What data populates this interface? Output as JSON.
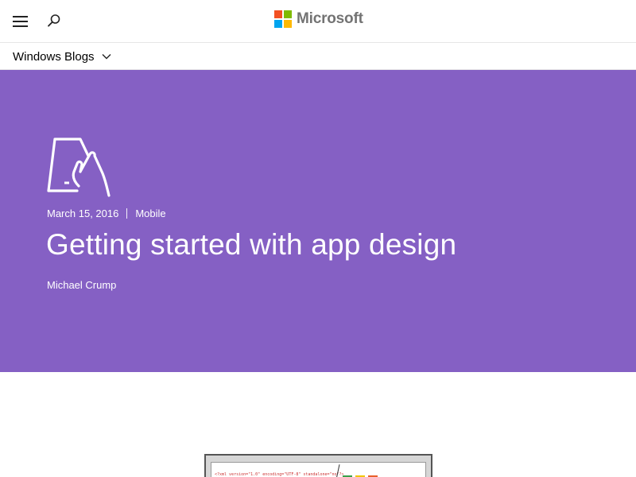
{
  "header": {
    "brand_name": "Microsoft",
    "brand_colors": [
      "#f25022",
      "#7fba00",
      "#00a4ef",
      "#ffb900"
    ],
    "menu_icon": "hamburger-menu-icon",
    "search_icon": "search-icon"
  },
  "subnav": {
    "section_label": "Windows Blogs",
    "dropdown_icon": "chevron-down-icon"
  },
  "hero": {
    "background_color": "#8560c4",
    "category_icon": "mobile-tap-icon",
    "date": "March 15, 2016",
    "category": "Mobile",
    "title": "Getting started with app design",
    "author": "Michael Crump"
  },
  "article": {
    "image_icon": "app-design-screenshot-image",
    "code_snippet": "<?xml version=\"1.0\" encoding=\"UTF-8\" standalone=\"no\"?>"
  }
}
